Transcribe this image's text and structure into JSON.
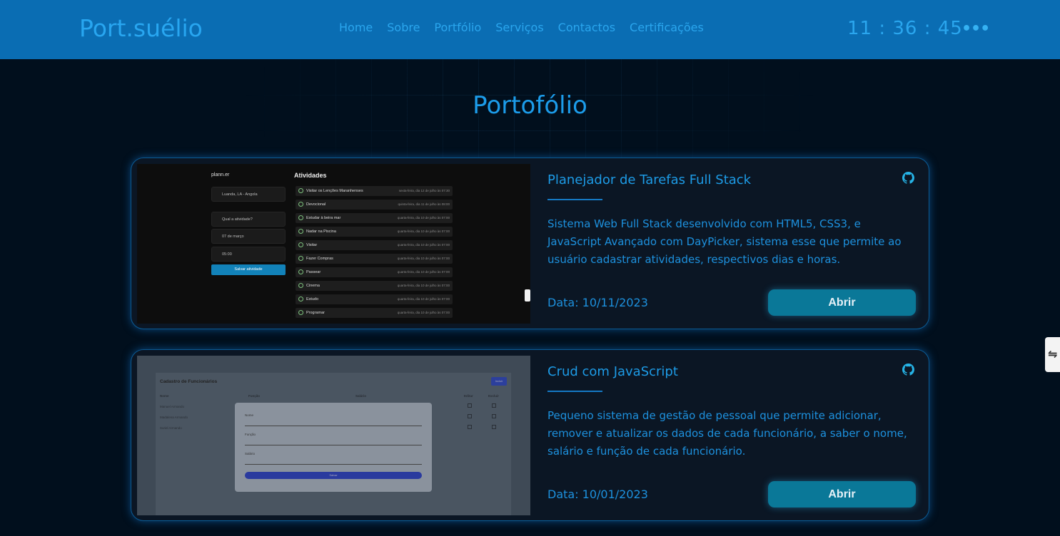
{
  "header": {
    "brand": "Port.suélio",
    "nav": [
      "Home",
      "Sobre",
      "Portfólio",
      "Serviços",
      "Contactos",
      "Certificações"
    ],
    "clock": "11 : 36 : 45",
    "menu_icon": "more-dots-icon"
  },
  "section_title": "Portofólio",
  "colors": {
    "header_bg": "#0a6db3",
    "page_bg": "#010f1d",
    "accent": "#1d9be6",
    "button_bg": "#0a7898"
  },
  "projects": [
    {
      "title": "Planejador de Tarefas Full Stack",
      "description": "Sistema Web Full Stack desenvolvido com HTML5, CSS3, e JavaScript Avançado com DayPicker, sistema esse que permite ao usuário cadastrar atividades, respectivos dias e horas.",
      "date": "Data: 10/11/2023",
      "button": "Abrir",
      "icon": "github-icon",
      "preview": {
        "logo": "plann.er",
        "location": "Luanda, LA - Angola",
        "activity_placeholder": "Qual a atividade?",
        "date_field": "07 de março",
        "time_field": "05:00",
        "save_label": "Salvar atividade",
        "heading": "Atividades",
        "rows": [
          {
            "name": "Visitar os Lenções Maranhenses",
            "date": "sexta-feira, dia 12 de julho às 07:30"
          },
          {
            "name": "Devocional",
            "date": "quinta-feira, dia 11 de julho às 08:00"
          },
          {
            "name": "Estudar à beira mar",
            "date": "quarta-feira, dia 10 de julho às 07:00"
          },
          {
            "name": "Nadar na Piscina",
            "date": "quarta-feira, dia 10 de julho às 07:00"
          },
          {
            "name": "Visitar",
            "date": "quarta-feira, dia 10 de julho às 07:00"
          },
          {
            "name": "Fazer Compras",
            "date": "quarta-feira, dia 10 de julho às 07:00"
          },
          {
            "name": "Passear",
            "date": "quarta-feira, dia 10 de julho às 07:00"
          },
          {
            "name": "Cinema",
            "date": "quarta-feira, dia 10 de julho às 07:00"
          },
          {
            "name": "Estudo",
            "date": "quarta-feira, dia 10 de julho às 07:00"
          },
          {
            "name": "Programar",
            "date": "quarta-feira, dia 10 de julho às 07:00"
          }
        ]
      }
    },
    {
      "title": "Crud com JavaScript",
      "description": "Pequeno sistema de gestão de pessoal que permite adicionar, remover e atualizar os dados de cada funcionário, a saber o nome, salário e função de cada funcionário.",
      "date": "Data: 10/01/2023",
      "button": "Abrir",
      "icon": "github-icon",
      "preview": {
        "heading": "Cadastro de Funcionários",
        "add_label": "Incluir",
        "columns": [
          "Nome",
          "Função",
          "Salário",
          "Editar",
          "Excluir"
        ],
        "names": [
          "Manuel Armando",
          "Madalena Armando",
          "Suriel Armando"
        ],
        "fields": [
          "Nome",
          "Função",
          "Salário"
        ],
        "submit_label": "Salvar"
      }
    }
  ]
}
